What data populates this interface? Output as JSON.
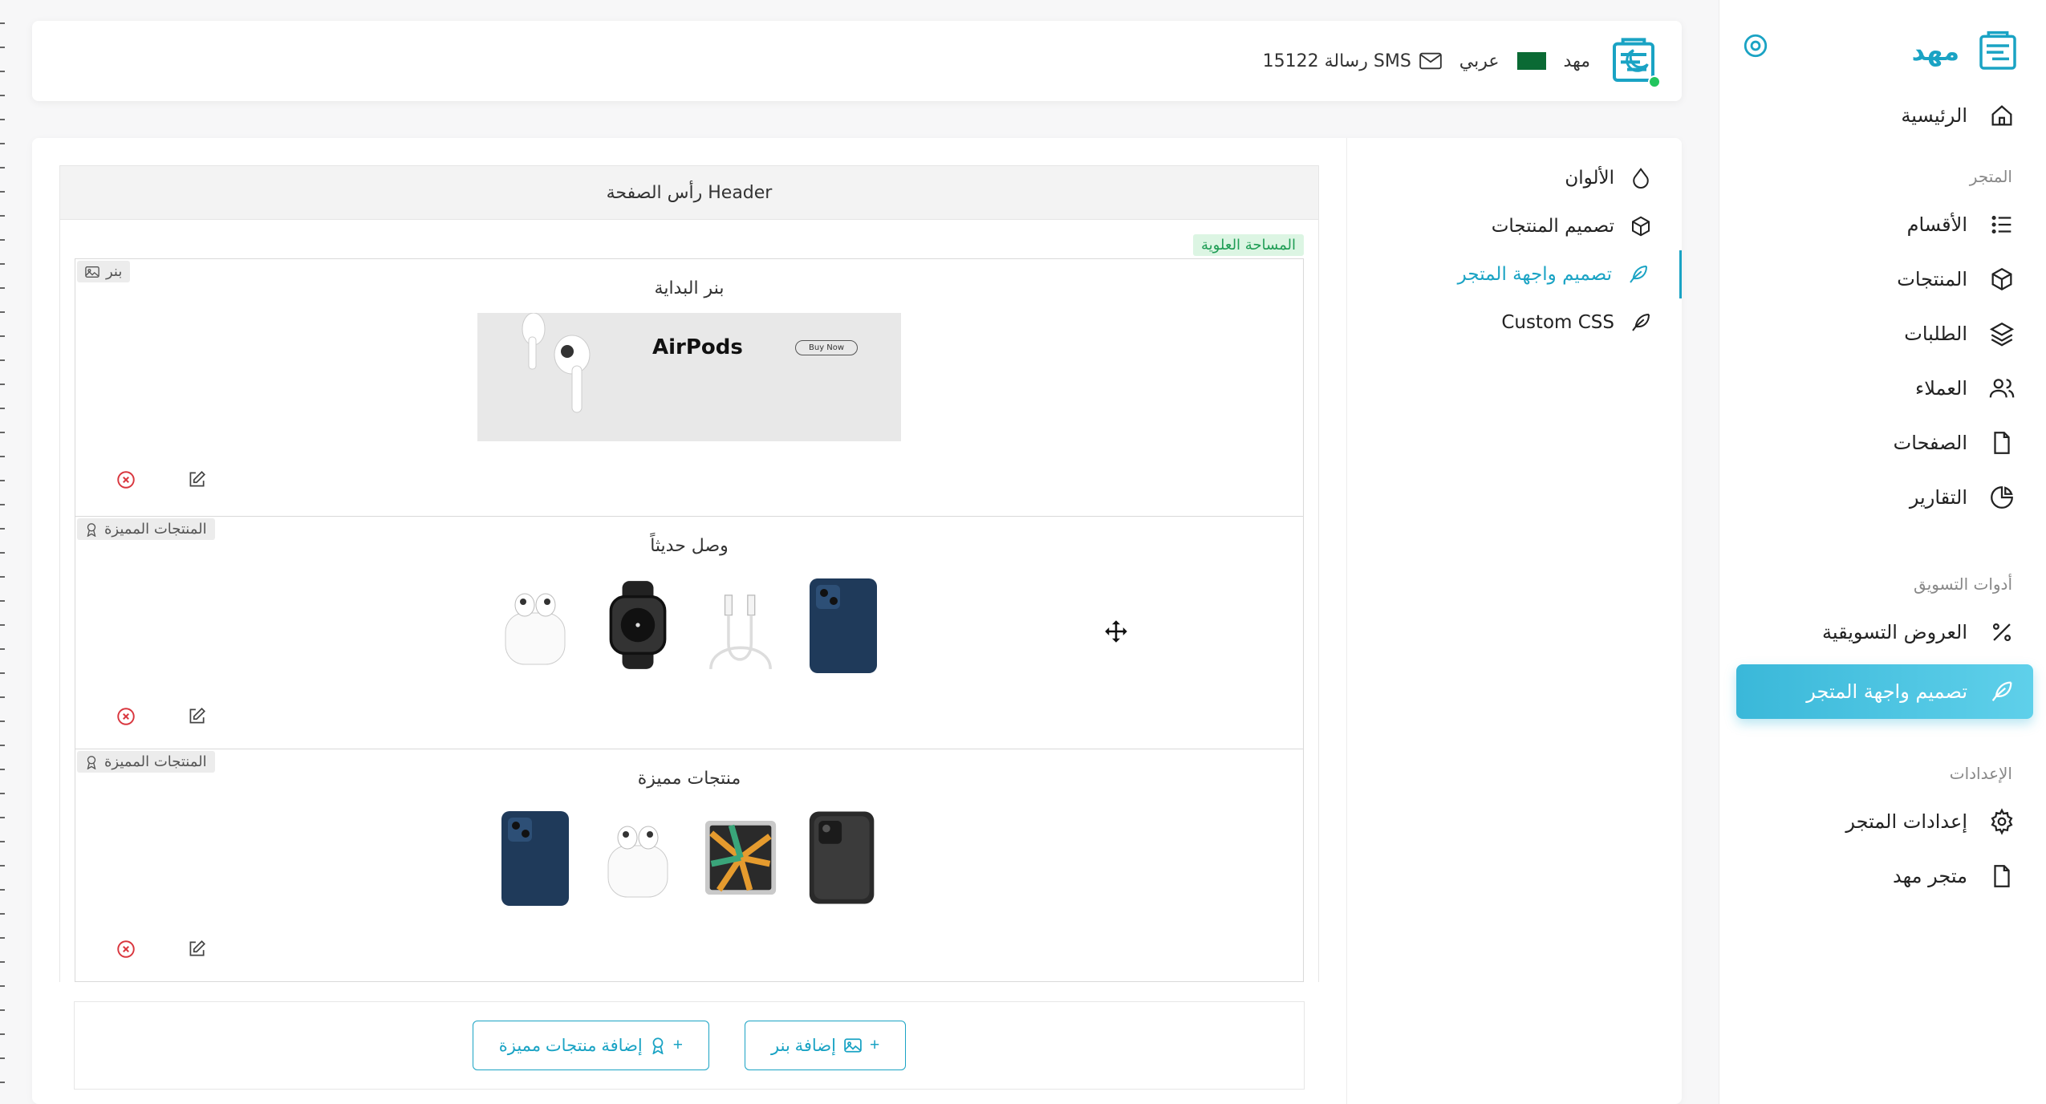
{
  "brand": {
    "name": "مهد"
  },
  "sidebar": {
    "home": "الرئيسية",
    "section_store": "المتجر",
    "categories": "الأقسام",
    "products": "المنتجات",
    "orders": "الطلبات",
    "customers": "العملاء",
    "pages": "الصفحات",
    "reports": "التقارير",
    "section_marketing": "أدوات التسويق",
    "offers": "العروض التسويقية",
    "storefront": "تصميم واجهة المتجر",
    "section_settings": "الإعدادات",
    "store_settings": "إعدادات المتجر",
    "store_page": "متجر مهد"
  },
  "topbar": {
    "sms": "15122 رسالة SMS",
    "language": "عربي",
    "user": "مهد"
  },
  "subnav": {
    "colors": "الألوان",
    "product_design": "تصميم المنتجات",
    "storefront_design": "تصميم واجهة المتجر",
    "custom_css": "Custom CSS"
  },
  "builder": {
    "header_title": "رأس الصفحة Header",
    "zone_tag": "المساحة العلوية",
    "sections": [
      {
        "title": "بنر البداية",
        "badge": "بنر"
      },
      {
        "title": "وصل حديثاً",
        "badge": "المنتجات المميزة"
      },
      {
        "title": "منتجات مميزة",
        "badge": "المنتجات المميزة"
      }
    ],
    "banner_text": "AirPods",
    "banner_button": "Buy Now",
    "add_banner": "إضافة بنر",
    "add_featured": "إضافة منتجات مميزة",
    "plus": "+"
  },
  "colors": {
    "accent": "#1aa3c4",
    "danger": "#d9363e",
    "success": "#22c55e"
  }
}
